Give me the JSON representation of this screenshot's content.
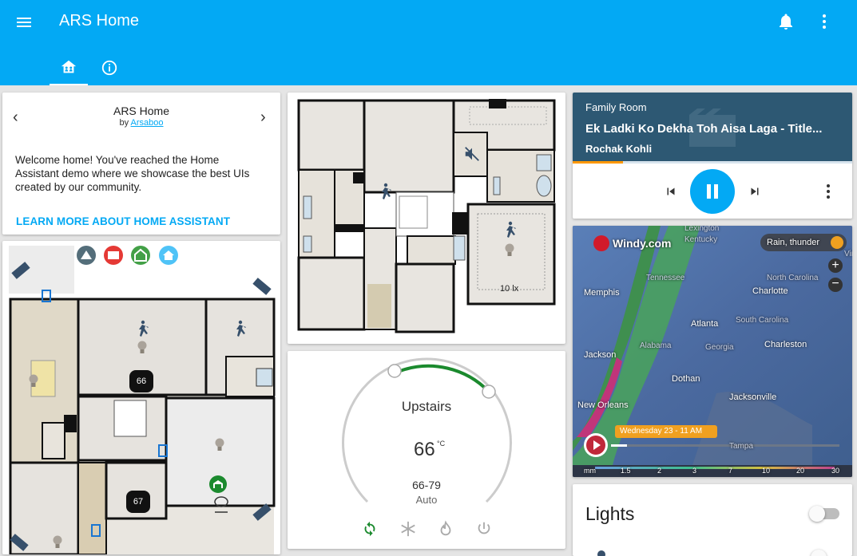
{
  "app": {
    "title": "ARS Home"
  },
  "tabs": [
    {
      "name": "home"
    },
    {
      "name": "info"
    }
  ],
  "intro": {
    "title": "ARS Home",
    "by_prefix": "by",
    "author": "Arsaboo",
    "welcome": "Welcome home! You've reached the Home Assistant demo where we showcase the best UIs created by our community.",
    "learn_more": "LEARN MORE ABOUT HOME ASSISTANT"
  },
  "floorplan_upstairs": {
    "lux": "10 lx"
  },
  "floorplan_downstairs": {
    "thermostat_a": "66",
    "thermostat_b": "67"
  },
  "thermostat": {
    "name": "Upstairs",
    "current_temp": "66",
    "unit": "°C",
    "range": "66-79",
    "mode": "Auto",
    "arc_colors": {
      "track": "#cccccc",
      "active": "#1b8a2e"
    }
  },
  "media": {
    "room": "Family Room",
    "title": "Ek Ladki Ko Dekha Toh Aisa Laga - Title...",
    "artist": "Rochak Kohli",
    "progress": 0.18,
    "accent": "#03a9f4"
  },
  "windy": {
    "brand": "Windy.com",
    "overlay": "Rain, thunder",
    "time": "Wednesday 23 - 11 AM",
    "places": [
      "Lexington",
      "Kentucky",
      "Memphis",
      "Tennessee",
      "North Carolina",
      "Charlotte",
      "Atlanta",
      "South Carolina",
      "Georgia",
      "Alabama",
      "Jackson",
      "Charleston",
      "Dothan",
      "Jacksonville",
      "New Orleans",
      "Tampa",
      "Vir"
    ],
    "scale": [
      "mm",
      "1.5",
      "2",
      "3",
      "7",
      "10",
      "20",
      "30"
    ]
  },
  "lights": {
    "title": "Lights"
  }
}
